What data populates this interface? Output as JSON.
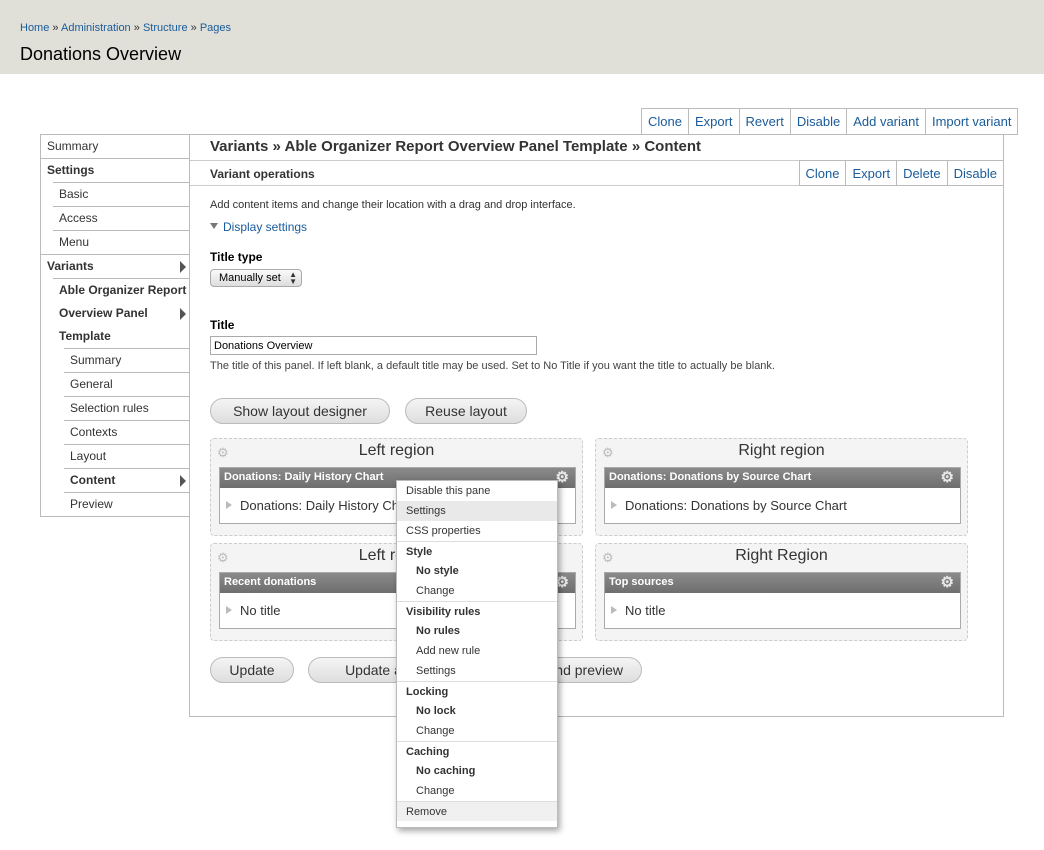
{
  "header": {
    "breadcrumb": [
      "Home",
      "Administration",
      "Structure",
      "Pages"
    ],
    "breadcrumb_separator": "»",
    "title": "Donations Overview"
  },
  "top_tabs": [
    "Clone",
    "Export",
    "Revert",
    "Disable",
    "Add variant",
    "Import variant"
  ],
  "sidebar": {
    "items": [
      {
        "label": "Summary"
      },
      {
        "label": "Settings"
      },
      {
        "label": "Basic"
      },
      {
        "label": "Access"
      },
      {
        "label": "Menu"
      },
      {
        "label": "Variants"
      },
      {
        "label": "Able Organizer Report Overview Panel Template"
      },
      {
        "label": "Summary"
      },
      {
        "label": "General"
      },
      {
        "label": "Selection rules"
      },
      {
        "label": "Contexts"
      },
      {
        "label": "Layout"
      },
      {
        "label": "Content"
      },
      {
        "label": "Preview"
      }
    ],
    "variant_lines": [
      "Able Organizer Report",
      "Overview Panel",
      "Template"
    ]
  },
  "main": {
    "variant_title": "Variants » Able Organizer Report Overview Panel Template » Content",
    "ops_label": "Variant operations",
    "ops_tabs": [
      "Clone",
      "Export",
      "Delete",
      "Disable"
    ],
    "intro": "Add content items and change their location with a drag and drop interface.",
    "display_settings": "Display settings",
    "title_type_label": "Title type",
    "title_type_value": "Manually set",
    "title_label": "Title",
    "title_value": "Donations Overview",
    "title_description": "The title of this panel. If left blank, a default title may be used. Set to No Title if you want the title to actually be blank.",
    "show_layout_designer": "Show layout designer",
    "reuse_layout": "Reuse layout",
    "update": "Update",
    "update_and_save": "Update and save",
    "update_and_preview": "Update and preview"
  },
  "regions": [
    {
      "title": "Left region",
      "pane_header": "Donations: Daily History Chart",
      "pane_body": "Donations: Daily History Chart"
    },
    {
      "title": "Right region",
      "pane_header": "Donations: Donations by Source Chart",
      "pane_body": "Donations: Donations by Source Chart"
    },
    {
      "title": "Left region",
      "pane_header": "Recent donations",
      "pane_body": "No title"
    },
    {
      "title": "Right Region",
      "pane_header": "Top sources",
      "pane_body": "No title"
    }
  ],
  "pane_menu": {
    "disable": "Disable this pane",
    "settings": "Settings",
    "css": "CSS properties",
    "style_head": "Style",
    "style_value": "No style",
    "style_change": "Change",
    "visibility_head": "Visibility rules",
    "visibility_value": "No rules",
    "visibility_add": "Add new rule",
    "visibility_settings": "Settings",
    "locking_head": "Locking",
    "locking_value": "No lock",
    "locking_change": "Change",
    "caching_head": "Caching",
    "caching_value": "No caching",
    "caching_change": "Change",
    "remove": "Remove"
  },
  "colors": {
    "header_bg": "#e0e0d8",
    "link": "#1a5b9a",
    "pane_header_bg": "#7a7a7a"
  }
}
